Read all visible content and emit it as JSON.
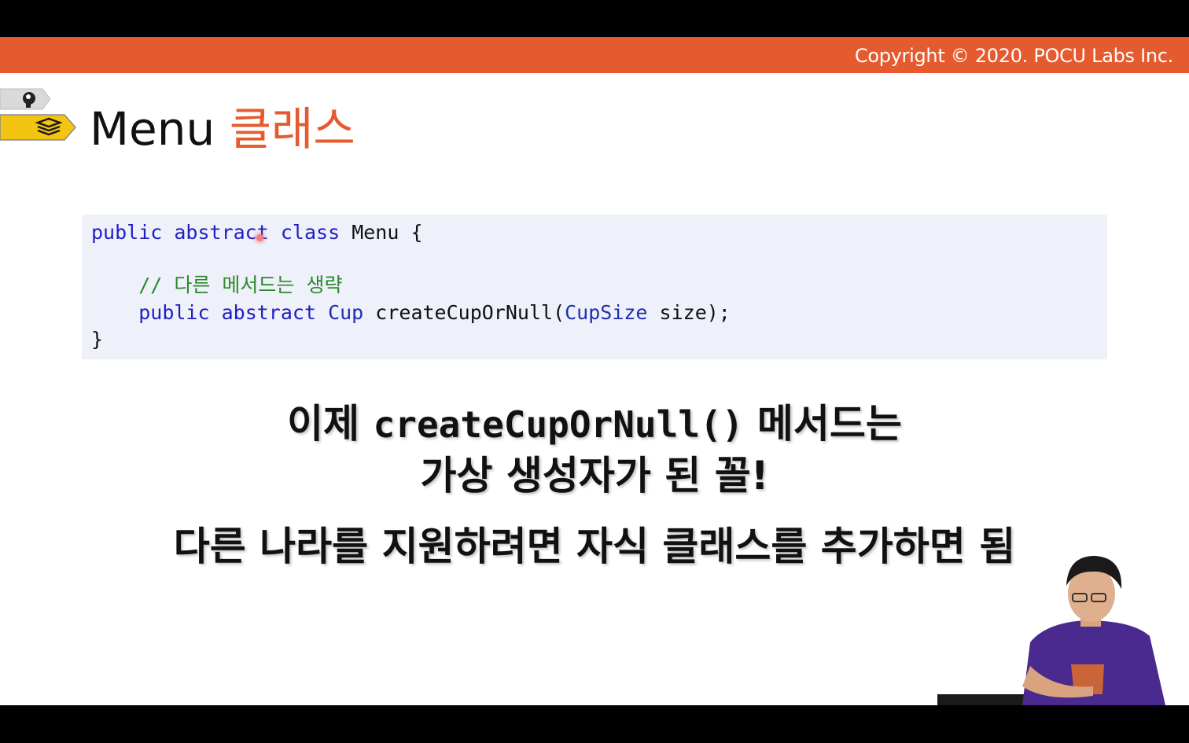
{
  "header": {
    "copyright": "Copyright © 2020. POCU Labs Inc."
  },
  "slide": {
    "title_main": "Menu",
    "title_accent": "클래스",
    "code": {
      "line1": {
        "kw1": "public",
        "kw2": "abstract",
        "kw3": "class",
        "name": "Menu",
        "brace": "{"
      },
      "line2_comment": "// 다른 메서드는 생략",
      "line3": {
        "kw1": "public",
        "kw2": "abstract",
        "ret_type": "Cup",
        "method": "createCupOrNull(",
        "param_type": "CupSize",
        "param_rest": "size);"
      },
      "line4": "}"
    },
    "statement_line1_pre": "이제",
    "statement_line1_code": "createCupOrNull()",
    "statement_line1_post": "메서드는",
    "statement_line2": "가상 생성자가 된 꼴!",
    "statement_line3": "다른 나라를 지원하려면 자식 클래스를 추가하면 됨"
  },
  "icons": {
    "tag_gray": "brain-head-icon",
    "tag_yellow": "books-stack-icon"
  },
  "colors": {
    "accent": "#e55a2e",
    "keyword": "#1f1fc4",
    "comment": "#2a8a2a",
    "code_bg": "#eef0fa"
  }
}
